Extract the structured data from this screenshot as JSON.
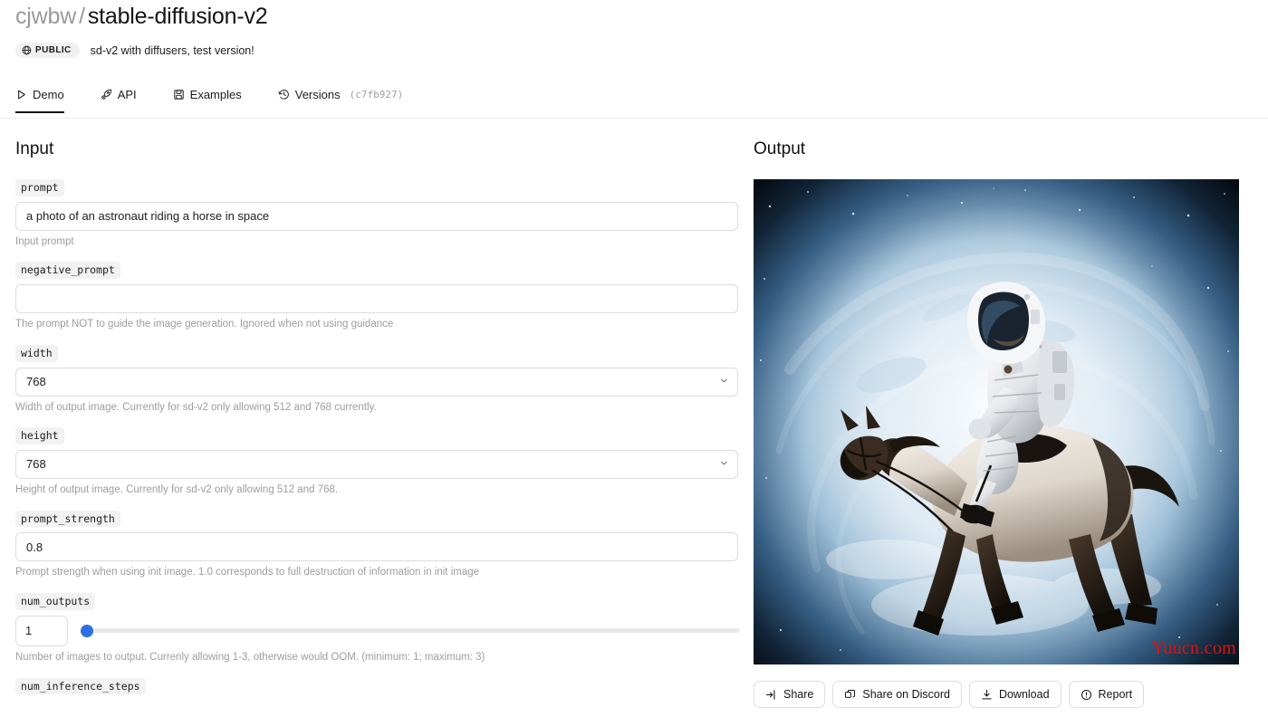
{
  "header": {
    "owner": "cjwbw",
    "separator": "/",
    "model_name": "stable-diffusion-v2",
    "visibility_badge": "PUBLIC",
    "description": "sd-v2 with diffusers, test version!"
  },
  "tabs": [
    {
      "label": "Demo",
      "icon": "play-icon",
      "active": true
    },
    {
      "label": "API",
      "icon": "rocket-icon",
      "active": false
    },
    {
      "label": "Examples",
      "icon": "save-disk-icon",
      "active": false
    },
    {
      "label": "Versions",
      "icon": "history-clock-icon",
      "active": false,
      "hash": "(c7fb927)"
    }
  ],
  "input": {
    "title": "Input",
    "fields": [
      {
        "name": "prompt",
        "type": "text",
        "value": "a photo of an astronaut riding a horse in space",
        "placeholder": "",
        "help": "Input prompt"
      },
      {
        "name": "negative_prompt",
        "type": "text",
        "value": "",
        "placeholder": "",
        "help": "The prompt NOT to guide the image generation. Ignored when not using guidance"
      },
      {
        "name": "width",
        "type": "select",
        "value": "768",
        "options": [
          "512",
          "768"
        ],
        "help": "Width of output image. Currently for sd-v2 only allowing 512 and 768 currently."
      },
      {
        "name": "height",
        "type": "select",
        "value": "768",
        "options": [
          "512",
          "768"
        ],
        "help": "Height of output image. Currently for sd-v2 only allowing 512 and 768."
      },
      {
        "name": "prompt_strength",
        "type": "text",
        "value": "0.8",
        "placeholder": "",
        "help": "Prompt strength when using init image. 1.0 corresponds to full destruction of information in init image"
      },
      {
        "name": "num_outputs",
        "type": "slider",
        "value": "1",
        "min": 1,
        "max": 3,
        "help": "Number of images to output. Currenly allowing 1-3, otherwise would OOM. (minimum: 1; maximum: 3)"
      },
      {
        "name": "num_inference_steps",
        "type": "partial",
        "value": "",
        "help": ""
      }
    ]
  },
  "output": {
    "title": "Output",
    "image_alt": "astronaut riding a horse in space above the curvature of earth",
    "watermark": "Yuucn.com",
    "actions": [
      {
        "label": "Share",
        "icon": "share-arrow-icon"
      },
      {
        "label": "Share on Discord",
        "icon": "copy-windows-icon"
      },
      {
        "label": "Download",
        "icon": "download-icon"
      },
      {
        "label": "Report",
        "icon": "report-alert-icon"
      }
    ]
  },
  "colors": {
    "accent_slider": "#2f6fe4",
    "watermark_red": "#e11313",
    "border": "#dcdcdc",
    "help_text": "#9d9d9d"
  }
}
